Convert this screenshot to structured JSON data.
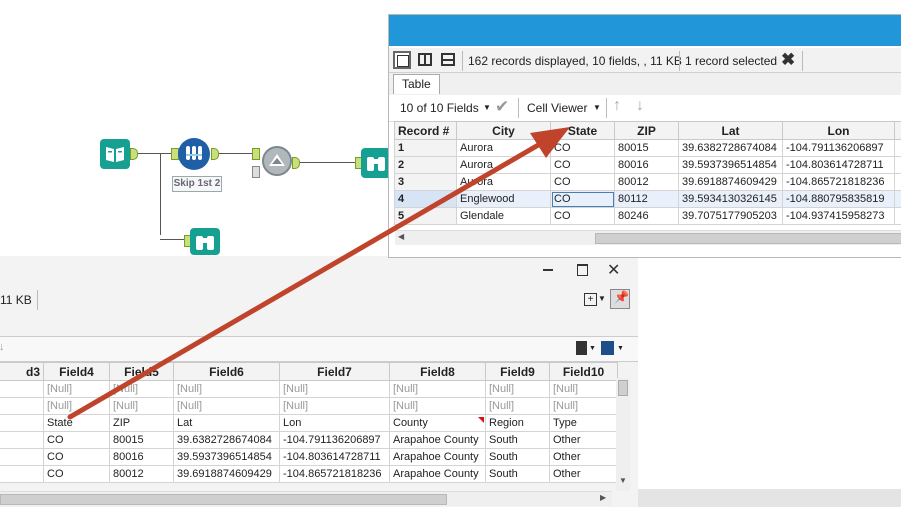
{
  "canvas": {
    "skip_label": "Skip 1st 2"
  },
  "results_top": {
    "status": "162 records displayed, 10 fields, , 11 KB",
    "selected": "1 record selected",
    "tab": "Table",
    "fields_selector": "10 of 10 Fields",
    "cell_viewer": "Cell Viewer",
    "columns": [
      "Record #",
      "City",
      "State",
      "ZIP",
      "Lat",
      "Lon"
    ],
    "rows": [
      [
        "1",
        "Aurora",
        "CO",
        "80015",
        "39.6382728674084",
        "-104.791136206897"
      ],
      [
        "2",
        "Aurora",
        "CO",
        "80016",
        "39.5937396514854",
        "-104.803614728711"
      ],
      [
        "3",
        "Aurora",
        "CO",
        "80012",
        "39.6918874609429",
        "-104.865721818236"
      ],
      [
        "4",
        "Englewood",
        "CO",
        "80112",
        "39.5934130326145",
        "-104.880795835819"
      ],
      [
        "5",
        "Glendale",
        "CO",
        "80246",
        "39.7075177905203",
        "-104.937415958273"
      ]
    ]
  },
  "results_bottom": {
    "size_fragment": "11 KB",
    "columns": [
      "d3",
      "Field4",
      "Field5",
      "Field6",
      "Field7",
      "Field8",
      "Field9",
      "Field10"
    ],
    "rows": [
      [
        "",
        "[Null]",
        "[Null]",
        "[Null]",
        "[Null]",
        "[Null]",
        "[Null]",
        "[Null]"
      ],
      [
        "",
        "[Null]",
        "[Null]",
        "[Null]",
        "[Null]",
        "[Null]",
        "[Null]",
        "[Null]"
      ],
      [
        "",
        "State",
        "ZIP",
        "Lat",
        "Lon",
        "County",
        "Region",
        "Type"
      ],
      [
        "",
        "CO",
        "80015",
        "39.6382728674084",
        "-104.791136206897",
        "Arapahoe County",
        "South",
        "Other"
      ],
      [
        "",
        "CO",
        "80016",
        "39.5937396514854",
        "-104.803614728711",
        "Arapahoe County",
        "South",
        "Other"
      ],
      [
        "",
        "CO",
        "80012",
        "39.6918874609429",
        "-104.865721818236",
        "Arapahoe County",
        "South",
        "Other"
      ]
    ]
  },
  "colors": {
    "titlebar": "#2196d9",
    "arrow": "#c0442b",
    "tool_teal": "#16a091",
    "tool_blue": "#1f5fa8"
  },
  "icons": [
    "input-book-icon",
    "sample-tool-icon",
    "dynamic-rename-icon",
    "browse-binoculars-icon",
    "layout-single-icon",
    "layout-split-icon",
    "layout-stack-icon",
    "close-x-icon",
    "checkmark-icon",
    "arrow-up-icon",
    "arrow-down-icon",
    "minimize-icon",
    "maximize-icon",
    "close-icon",
    "add-dropdown-icon",
    "pin-icon",
    "copy-icon",
    "save-icon"
  ]
}
